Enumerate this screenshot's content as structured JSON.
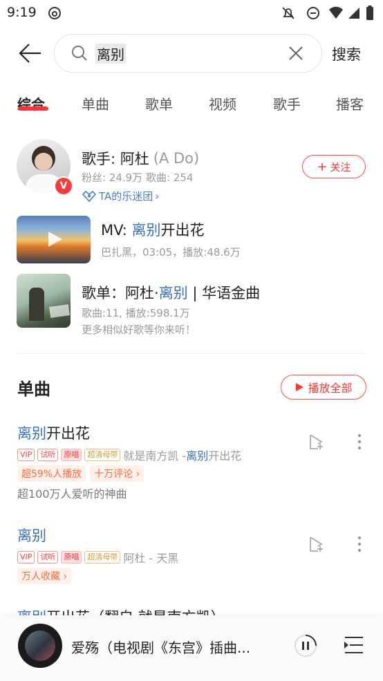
{
  "status": {
    "time": "9:19"
  },
  "search": {
    "query": "离别",
    "button": "搜索"
  },
  "tabs": [
    {
      "label": "综合"
    },
    {
      "label": "单曲"
    },
    {
      "label": "歌单"
    },
    {
      "label": "视频"
    },
    {
      "label": "歌手"
    },
    {
      "label": "播客"
    }
  ],
  "artist": {
    "title": "歌手: 阿杜",
    "alias": "(A Do)",
    "stats": "粉丝: 24.9万 歌曲: 254",
    "fanclub": "TA的乐迷团",
    "badge": "V",
    "follow": "关注"
  },
  "mv": {
    "prefix": "MV: ",
    "hl": "离别",
    "rest": "开出花",
    "meta": "巴扎黑，03:05，播放:48.6万"
  },
  "playlist": {
    "prefix": "歌单：阿杜·",
    "hl": "离别",
    "rest": " | 华语金曲",
    "meta": "歌曲:11, 播放:598.1万",
    "desc": "更多相似好歌等你来听！"
  },
  "songs_section": {
    "title": "单曲",
    "play_all": "播放全部"
  },
  "songs": [
    {
      "hl": "离别",
      "rest": "开出花",
      "tags": [
        "VIP",
        "试听",
        "原唱",
        "超清母带"
      ],
      "artist": "就是南方凯 - ",
      "album_hl": "离别",
      "album_rest": "开出花",
      "pills": [
        "超59%人播放",
        "十万评论 ›"
      ],
      "desc": "超100万人爱听的神曲"
    },
    {
      "hl": "离别",
      "rest": "",
      "tags": [
        "VIP",
        "试听",
        "原唱",
        "超清母带"
      ],
      "artist": "阿杜 - 天黑",
      "pills": [
        "万人收藏 ›"
      ]
    },
    {
      "hl": "离别",
      "rest": "开出花（翻自 就是南方凯）"
    }
  ],
  "player": {
    "title": "爱殇（电视剧《东宫》插曲..."
  },
  "colors": {
    "accent": "#ff3636",
    "highlight": "#3a6fbf"
  }
}
